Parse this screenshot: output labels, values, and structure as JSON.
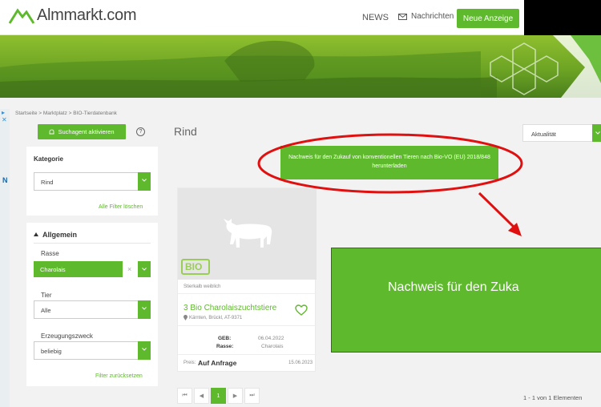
{
  "header": {
    "logo_text": "Almmarkt.com",
    "news_label": "NEWS",
    "messages_label": "Nachrichten",
    "new_ad_label": "Neue Anzeige"
  },
  "breadcrumb": "Startseite > Marktplatz > BIO-Tierdatenbank",
  "search_agent_label": "Suchagent aktivieren",
  "help_glyph": "?",
  "page_title": "Rind",
  "sort": {
    "value": "Aktualität"
  },
  "notice_small": "Nachweis für den Zukauf von konventionellen Tieren nach Bio-VO (EU) 2018/848 herunterladen",
  "notice_big": "Nachweis für den Zuka",
  "filters": {
    "category_title": "Kategorie",
    "category_value": "Rind",
    "clear_all_label": "Alle Filter löschen",
    "general_title": "Allgemein",
    "breed_label": "Rasse",
    "breed_value": "Charolais",
    "clear_glyph": "×",
    "animal_label": "Tier",
    "animal_value": "Alle",
    "purpose_label": "Erzeugungszweck",
    "purpose_value": "beliebig",
    "reset_label": "Filter zurücksetzen"
  },
  "listing": {
    "badge": "BIO",
    "category": "Stierkalb weiblich",
    "title": "3 Bio Charolaiszuchtstiere",
    "location": "Kärnten, Brückl, AT-9371",
    "birth_label": "GEB:",
    "birth_value": "06.04.2022",
    "breed_label": "Rasse:",
    "breed_value": "Charolais",
    "price_label": "Preis:",
    "price_value": "Auf Anfrage",
    "date": "15.06.2023"
  },
  "pagination": {
    "first": "⏮",
    "prev": "◀",
    "current": "1",
    "next": "▶",
    "last": "⏭"
  },
  "results_text": "1 - 1 von 1 Elementen",
  "left_strip": {
    "close": "▸ ✕",
    "letter": "N"
  },
  "colors": {
    "brand_green": "#5fb92d",
    "annotation_red": "#e01010"
  }
}
